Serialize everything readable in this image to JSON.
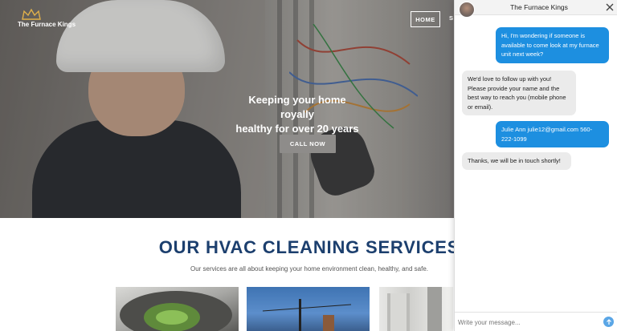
{
  "brand": {
    "name": "The Furnace Kings",
    "crown_color": "#e0b04a"
  },
  "nav": {
    "home_label": "HOME",
    "next_label": "S"
  },
  "hero": {
    "headline_line1": "Keeping your home royally",
    "headline_line2": "healthy for over 20 years",
    "cta_label": "CALL NOW"
  },
  "services": {
    "title": "OUR HVAC CLEANING SERVICES",
    "subtitle": "Our services are all about keeping your home environment clean, healthy, and safe."
  },
  "chat": {
    "title": "The Furnace Kings",
    "close_icon": "close-icon",
    "messages": [
      {
        "from": "visitor",
        "text": "Hi, I'm wondering if someone is available to come look at my furnace unit next week?"
      },
      {
        "from": "agent",
        "text": "We'd love to follow up with you! Please provide your name and the best way to reach you (mobile phone or email)."
      },
      {
        "from": "visitor",
        "text": "Julie Ann julie12@gmail.com 560-222-1099"
      },
      {
        "from": "agent",
        "text": "Thanks, we will be in touch shortly!"
      }
    ],
    "input_placeholder": "Write your message...",
    "send_icon": "send-arrow-icon",
    "visitor_bubble_color": "#1d8fe0",
    "agent_bubble_color": "#ebebeb"
  },
  "colors": {
    "title_blue": "#1c3f6e"
  }
}
